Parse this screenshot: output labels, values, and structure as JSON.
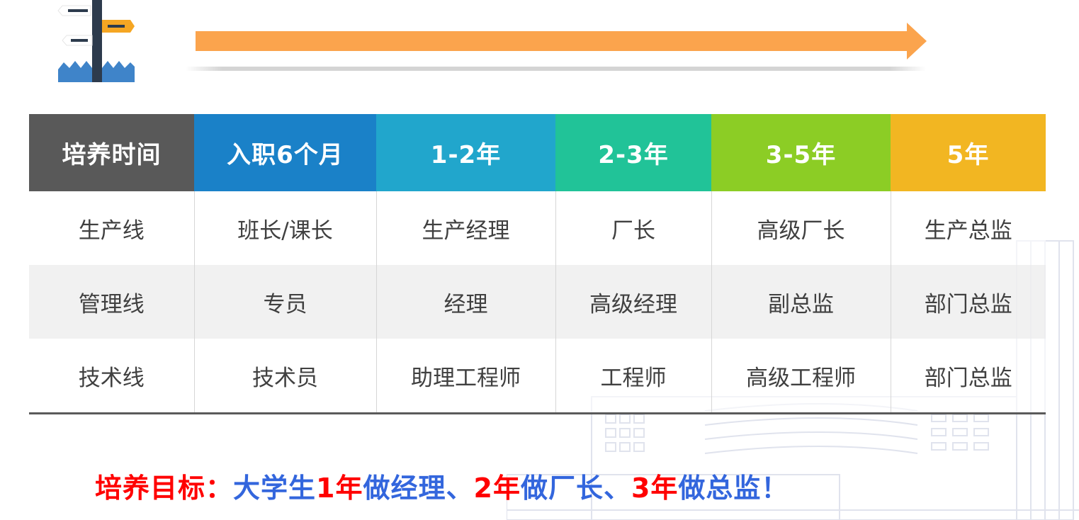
{
  "table": {
    "header": [
      {
        "label": "培养时间",
        "color": "#595959"
      },
      {
        "label": "入职6个月",
        "color": "#1a81c8"
      },
      {
        "label": "1-2年",
        "color": "#21a6cc"
      },
      {
        "label": "2-3年",
        "color": "#21c398"
      },
      {
        "label": "3-5年",
        "color": "#8ccd25"
      },
      {
        "label": "5年",
        "color": "#f2b622"
      }
    ],
    "rows": [
      {
        "cells": [
          "生产线",
          "班长/课长",
          "生产经理",
          "厂长",
          "高级厂长",
          "生产总监"
        ]
      },
      {
        "cells": [
          "管理线",
          "专员",
          "经理",
          "高级经理",
          "副总监",
          "部门总监"
        ]
      },
      {
        "cells": [
          "技术线",
          "技术员",
          "助理工程师",
          "工程师",
          "高级工程师",
          "部门总监"
        ]
      }
    ]
  },
  "slogan": {
    "parts": [
      {
        "text": "培养目标：",
        "color": "#ff0000"
      },
      {
        "text": "大学生",
        "color": "#3366dd"
      },
      {
        "text": "1年",
        "color": "#ff0000"
      },
      {
        "text": "做经理、",
        "color": "#3366dd"
      },
      {
        "text": "2年",
        "color": "#ff0000"
      },
      {
        "text": "做厂长、",
        "color": "#3366dd"
      },
      {
        "text": "3年",
        "color": "#ff0000"
      },
      {
        "text": "做总监！",
        "color": "#3366dd"
      }
    ]
  },
  "decor": {
    "arrow_color": "#fba44d",
    "signpost_icon": "signpost-icon",
    "watermark": "building-watermark"
  }
}
